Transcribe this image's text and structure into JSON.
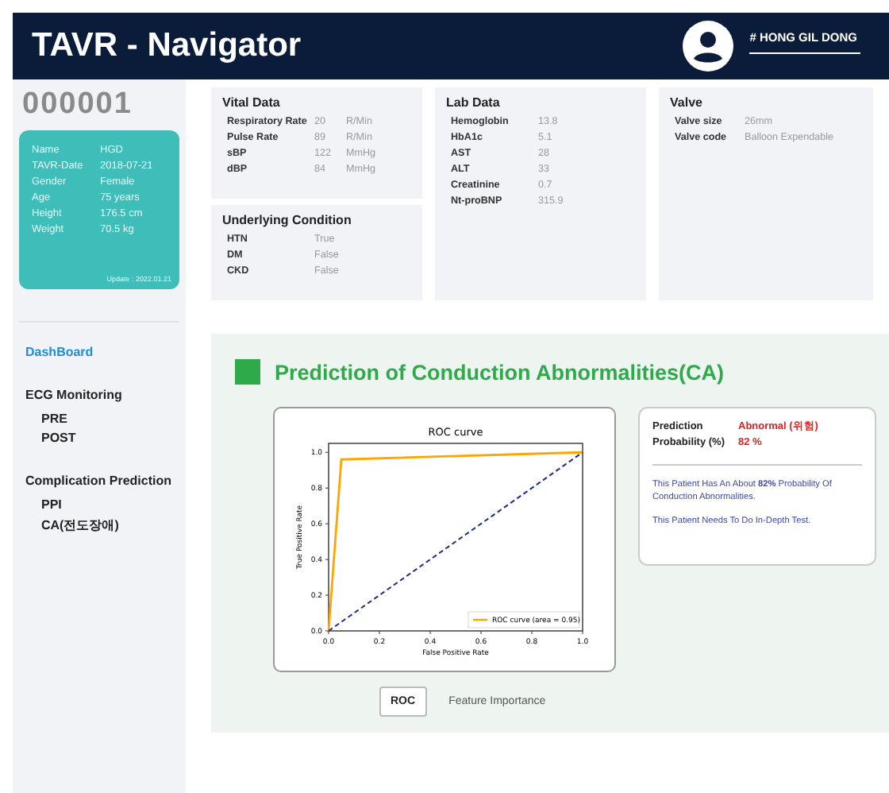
{
  "header": {
    "title": "TAVR - Navigator",
    "user": "# HONG GIL DONG"
  },
  "patient": {
    "id": "000001",
    "fields": [
      {
        "label": "Name",
        "value": "HGD"
      },
      {
        "label": "TAVR-Date",
        "value": "2018-07-21"
      },
      {
        "label": "Gender",
        "value": "Female"
      },
      {
        "label": "Age",
        "value": "75 years"
      },
      {
        "label": "Height",
        "value": "176.5 cm"
      },
      {
        "label": "Weight",
        "value": "70.5 kg"
      }
    ],
    "update": "Update : 2022.01.21"
  },
  "nav": [
    {
      "kind": "link",
      "label": "DashBoard",
      "selected": true
    },
    {
      "kind": "section",
      "label": "ECG Monitoring",
      "items": [
        {
          "label": "PRE",
          "selected": false
        },
        {
          "label": "POST",
          "selected": false
        }
      ]
    },
    {
      "kind": "section",
      "label": "Complication Prediction",
      "items": [
        {
          "label": "PPI",
          "selected": false
        },
        {
          "label": "CA(전도장애)",
          "selected": false
        }
      ]
    }
  ],
  "cards": [
    {
      "title": "Vital Data",
      "rows": [
        {
          "label": "Respiratory Rate",
          "value": "20",
          "unit": "R/Min"
        },
        {
          "label": "Pulse Rate",
          "value": "89",
          "unit": "R/Min"
        },
        {
          "label": "sBP",
          "value": "122",
          "unit": "MmHg"
        },
        {
          "label": "dBP",
          "value": "84",
          "unit": "MmHg"
        }
      ]
    },
    {
      "title": "Underlying Condition",
      "rows": [
        {
          "label": "HTN",
          "value": "True"
        },
        {
          "label": "DM",
          "value": "False"
        },
        {
          "label": "CKD",
          "value": "False"
        }
      ]
    },
    {
      "title": "Lab Data",
      "rows": [
        {
          "label": "Hemoglobin",
          "value": "13.8"
        },
        {
          "label": "HbA1c",
          "value": "5.1"
        },
        {
          "label": "AST",
          "value": "28"
        },
        {
          "label": "ALT",
          "value": "33"
        },
        {
          "label": "Creatinine",
          "value": "0.7"
        },
        {
          "label": "Nt-proBNP",
          "value": "315.9"
        }
      ]
    },
    {
      "title": "Valve",
      "rows": [
        {
          "label": "Valve size",
          "value": "26mm"
        },
        {
          "label": "Valve code",
          "value": "Balloon Expendable"
        }
      ]
    }
  ],
  "ca": {
    "title": "Prediction of Conduction Abnormalities(CA)",
    "chart_data": {
      "type": "line",
      "title": "ROC curve",
      "xlabel": "False Positive Rate",
      "ylabel": "True Positive Rate",
      "x": [
        0,
        0.05,
        1
      ],
      "xlim": [
        0,
        1
      ],
      "ylim": [
        0,
        1.05
      ],
      "xticks": [
        {
          "value": 0,
          "label": "0.0"
        },
        0.2,
        0.4,
        0.6,
        0.8,
        {
          "value": 1,
          "label": "1.0"
        }
      ],
      "yticks": [
        {
          "value": 0,
          "label": "0.0"
        },
        0.2,
        0.4,
        0.6,
        0.8,
        {
          "value": 1,
          "label": "1.0"
        }
      ],
      "series": [
        {
          "name": "ROC curve (area = 0.95)",
          "color": "#ffa500",
          "values": [
            0,
            0.96,
            1
          ]
        },
        {
          "color": "#1f2d8a",
          "line_style": "dashed",
          "values": [
            0,
            0.05,
            1
          ]
        }
      ]
    },
    "result": [
      {
        "label": "Prediction",
        "value": "Abnormal (위험)"
      },
      {
        "label": "Probability (%)",
        "value": "82 %"
      }
    ],
    "messages": [
      "This Patient Has An About **82%** Probability Of Conduction Abnormalities.",
      "This Patient Needs To Do In-Depth Test."
    ],
    "tabs": [
      {
        "label": "ROC",
        "selected": true
      },
      {
        "label": "Feature Importance",
        "selected": false
      }
    ]
  }
}
